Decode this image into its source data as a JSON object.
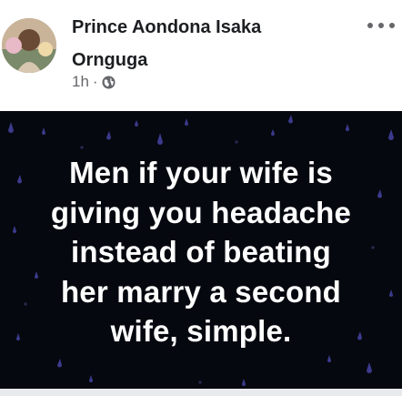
{
  "post": {
    "author_line1": "Prince Aondona Isaka",
    "author_line2": "Ornguga",
    "time": "1h",
    "separator": "·",
    "privacy_icon": "globe-icon",
    "more_icon": "ellipsis-icon"
  },
  "content": {
    "lines": [
      "Men if your wife is",
      "giving you headache",
      "instead of beating",
      "her marry a second",
      "wife, simple."
    ],
    "background_color": "#06080f",
    "text_color": "#ffffff",
    "drop_color": "#3b3a8c"
  }
}
